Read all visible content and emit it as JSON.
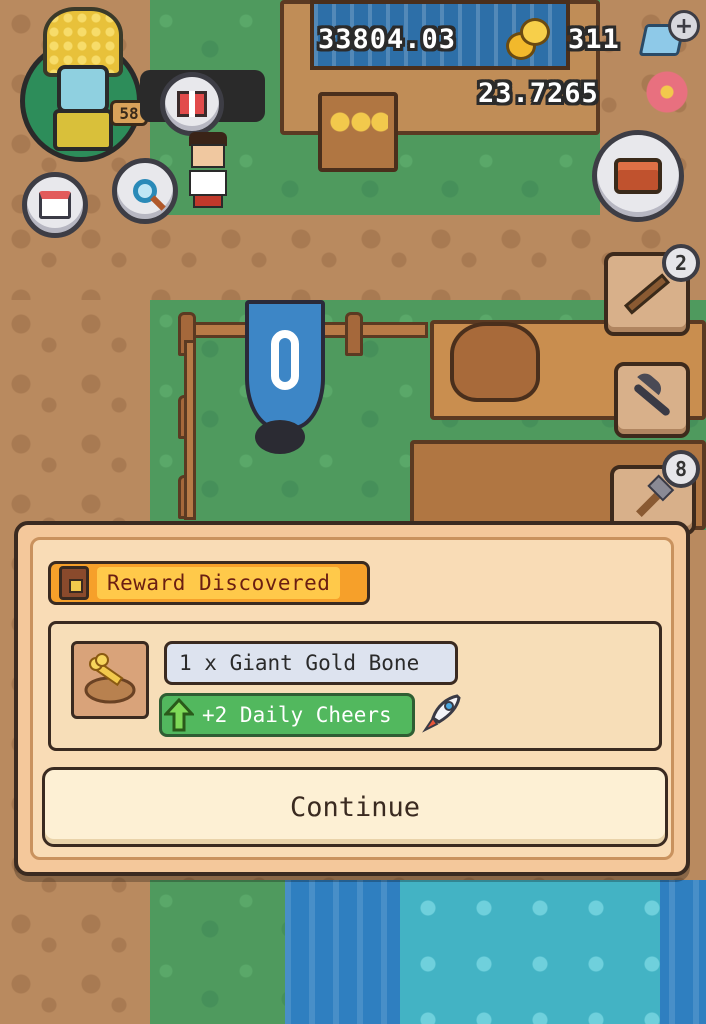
{
  "hud": {
    "coins": "33804.03",
    "gems": "311",
    "flowers": "23.7265",
    "level": "58"
  },
  "badges": {
    "tool_count": "2",
    "axe_count": "8"
  },
  "modal": {
    "title": "Reward Discovered",
    "item_text": "1 x Giant Gold Bone",
    "cheer_text": "+2 Daily Cheers",
    "continue_label": "Continue"
  },
  "colors": {
    "modal_bg": "#f4c89b",
    "title_chip": "#f6a02a",
    "cheer_chip": "#52b85e",
    "item_chip": "#dde3ef"
  },
  "icons": [
    "gold-coins-icon",
    "gem-icon",
    "flower-icon",
    "gift-icon",
    "calendar-icon",
    "magnifier-icon",
    "toolbox-icon",
    "crossbow-icon",
    "pickaxe-icon",
    "axe-icon",
    "chest-icon",
    "gold-bone-icon",
    "up-arrow-icon",
    "rocket-icon"
  ]
}
